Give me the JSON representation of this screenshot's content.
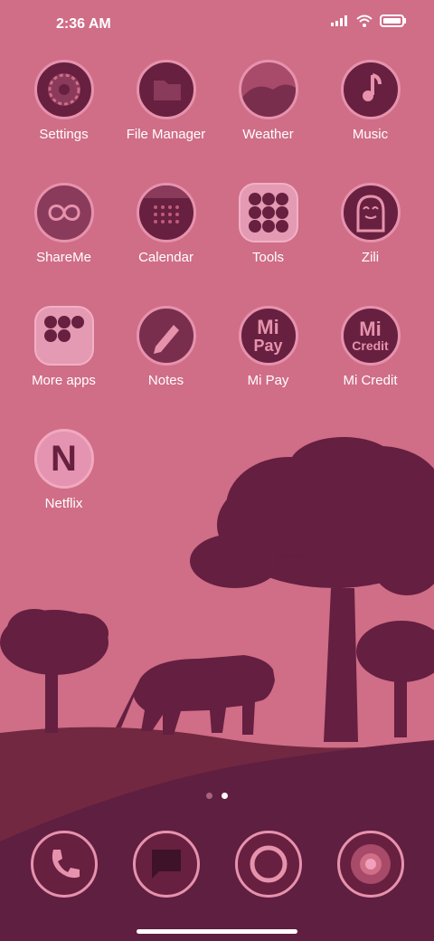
{
  "status_bar": {
    "time": "2:36 AM",
    "icons": [
      "signal-icon",
      "wifi-icon",
      "battery-icon"
    ]
  },
  "apps": [
    {
      "name": "settings",
      "label": "Settings",
      "icon": "gear-icon"
    },
    {
      "name": "file-manager",
      "label": "File Manager",
      "icon": "folder-icon"
    },
    {
      "name": "weather",
      "label": "Weather",
      "icon": "cloud-icon"
    },
    {
      "name": "music",
      "label": "Music",
      "icon": "music-note-icon"
    },
    {
      "name": "shareme",
      "label": "ShareMe",
      "icon": "infinity-icon"
    },
    {
      "name": "calendar",
      "label": "Calendar",
      "icon": "calendar-icon"
    },
    {
      "name": "tools",
      "label": "Tools",
      "icon": "folder-grid-icon"
    },
    {
      "name": "zili",
      "label": "Zili",
      "icon": "ghost-icon"
    },
    {
      "name": "more-apps",
      "label": "More apps",
      "icon": "folder-grid-icon"
    },
    {
      "name": "notes",
      "label": "Notes",
      "icon": "pencil-icon"
    },
    {
      "name": "mi-pay",
      "label": "Mi Pay",
      "icon": "mi-pay-icon",
      "text_lines": [
        "Mi",
        "Pay"
      ]
    },
    {
      "name": "mi-credit",
      "label": "Mi Credit",
      "icon": "mi-credit-icon",
      "text_lines": [
        "Mi",
        "Credit"
      ]
    },
    {
      "name": "netflix",
      "label": "Netflix",
      "icon": "netflix-icon",
      "letter": "N"
    }
  ],
  "dock": [
    {
      "name": "phone",
      "icon": "phone-icon"
    },
    {
      "name": "messages",
      "icon": "message-icon"
    },
    {
      "name": "browser",
      "icon": "browser-icon"
    },
    {
      "name": "camera",
      "icon": "camera-icon"
    }
  ],
  "page_indicator": {
    "pages": 2,
    "active": 2
  },
  "colors": {
    "sky": "#d06d87",
    "silhouette": "#641f41",
    "hill": "#6d2440",
    "icon_border": "#e792ad",
    "text": "#ffffff"
  }
}
